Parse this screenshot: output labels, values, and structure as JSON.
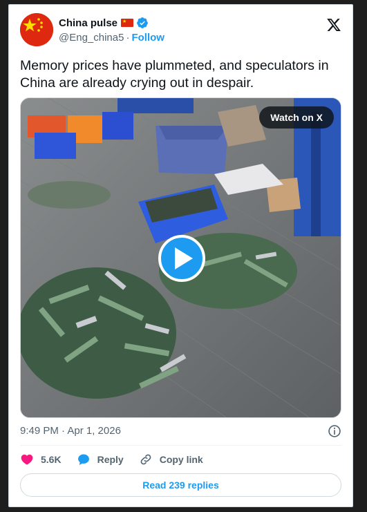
{
  "author": {
    "display_name": "China pulse",
    "flag_emoji": "CN-flag",
    "handle": "@Eng_china5",
    "separator": "·",
    "follow_label": "Follow",
    "verified_color": "#1d9bf0"
  },
  "tweet": {
    "text": "Memory prices have plummeted, and speculators in China are already crying out in despair."
  },
  "media": {
    "watch_label": "Watch on X",
    "play_icon": "play-icon"
  },
  "meta": {
    "timestamp": "9:49 PM · Apr 1, 2026"
  },
  "actions": {
    "like_count": "5.6K",
    "reply_label": "Reply",
    "copy_link_label": "Copy link"
  },
  "footer": {
    "read_replies_label": "Read 239 replies"
  },
  "colors": {
    "accent": "#1d9bf0",
    "like": "#f91880",
    "text": "#0f1419",
    "muted": "#536471"
  }
}
